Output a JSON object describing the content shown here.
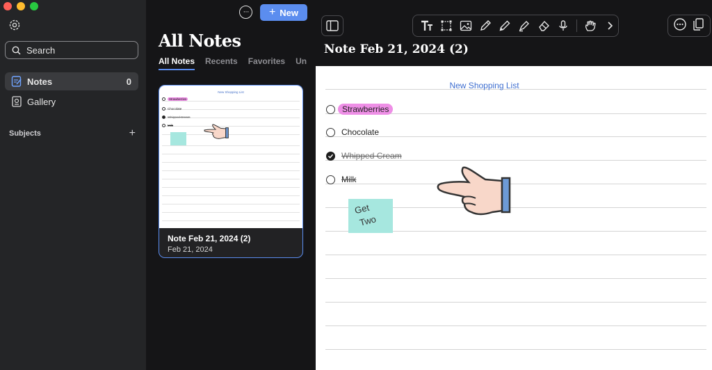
{
  "window": {
    "traffic_colors": [
      "#fe5f57",
      "#febc2e",
      "#28c840"
    ]
  },
  "sidebar": {
    "search_label": "Search",
    "items": [
      {
        "label": "Notes",
        "count": "0",
        "icon": "notes-icon"
      },
      {
        "label": "Gallery",
        "icon": "gallery-icon"
      }
    ],
    "subjects_label": "Subjects",
    "add_symbol": "+"
  },
  "list": {
    "more_symbol": "···",
    "new_label": "New",
    "new_symbol": "+",
    "title": "All Notes",
    "tabs": [
      "All Notes",
      "Recents",
      "Favorites",
      "Un"
    ],
    "card": {
      "title": "Note Feb 21, 2024 (2)",
      "date": "Feb 21, 2024",
      "thumb_title": "New Shopping List",
      "thumb_items": [
        "Strawberries",
        "Chocolate",
        "Whipped Cream",
        "Milk"
      ]
    }
  },
  "editor": {
    "title": "Note Feb 21, 2024 (2)",
    "tools": [
      "text-tool-icon",
      "select-tool-icon",
      "image-tool-icon",
      "pen-tool-icon",
      "pencil-tool-icon",
      "highlighter-tool-icon",
      "eraser-tool-icon",
      "microphone-icon",
      "hand-tool-icon",
      "chevron-right-icon"
    ],
    "note": {
      "heading": "New Shopping List",
      "items": [
        {
          "text": "Strawberries",
          "checked": false,
          "style": "highlight"
        },
        {
          "text": "Chocolate",
          "checked": false,
          "style": "plain"
        },
        {
          "text": "Whipped Cream",
          "checked": true,
          "style": "strike"
        },
        {
          "text": "Milk",
          "checked": false,
          "style": "strike"
        }
      ],
      "sticky_line1": "Get",
      "sticky_line2": "Two"
    }
  },
  "colors": {
    "accent": "#5b8def",
    "highlight": "#ee8fe6",
    "sticky": "#a6e7df",
    "heading_blue": "#3f6fd0"
  }
}
